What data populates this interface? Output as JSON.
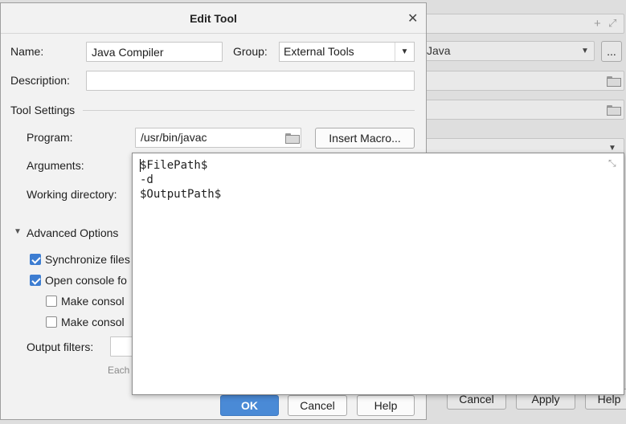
{
  "dialog": {
    "title": "Edit Tool",
    "name_label": "Name:",
    "name_value": "Java Compiler",
    "group_label": "Group:",
    "group_value": "External Tools",
    "description_label": "Description:",
    "description_value": "",
    "tool_settings_label": "Tool Settings",
    "program_label": "Program:",
    "program_value": "/usr/bin/javac",
    "insert_macro_label": "Insert Macro...",
    "arguments_label": "Arguments:",
    "working_dir_label": "Working directory:",
    "advanced_label": "Advanced Options",
    "sync_files_label": "Synchronize files",
    "open_console_label": "Open console fo",
    "make_console_1_label": "Make consol",
    "make_console_2_label": "Make consol",
    "output_filters_label": "Output filters:",
    "hint_text": "Each",
    "ok_label": "OK",
    "cancel_label": "Cancel",
    "help_label": "Help"
  },
  "checkboxes": {
    "sync_files": true,
    "open_console": true,
    "make_console_1": false,
    "make_console_2": false
  },
  "arguments_popup": {
    "line1": "$FilePath$",
    "line2": "-d",
    "line3": "$OutputPath$"
  },
  "background": {
    "combo_value": "Java",
    "dots_label": "...",
    "cancel_label": "Cancel",
    "apply_label": "Apply",
    "help_label": "Help"
  },
  "colors": {
    "primary_button": "#4a8ad6",
    "checkbox_checked": "#3d7dd1"
  }
}
